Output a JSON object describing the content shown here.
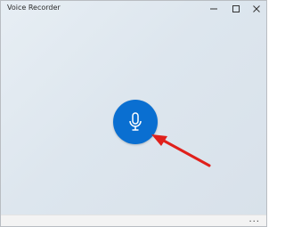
{
  "window": {
    "title": "Voice Recorder"
  },
  "window_controls": {
    "minimize_icon": "minimize-icon",
    "maximize_icon": "maximize-icon",
    "close_icon": "close-icon"
  },
  "main": {
    "record_button_icon": "microphone-icon",
    "accent_color": "#0a6fd1",
    "annotation_color": "#e0201b"
  },
  "footer": {
    "more_label": "..."
  }
}
